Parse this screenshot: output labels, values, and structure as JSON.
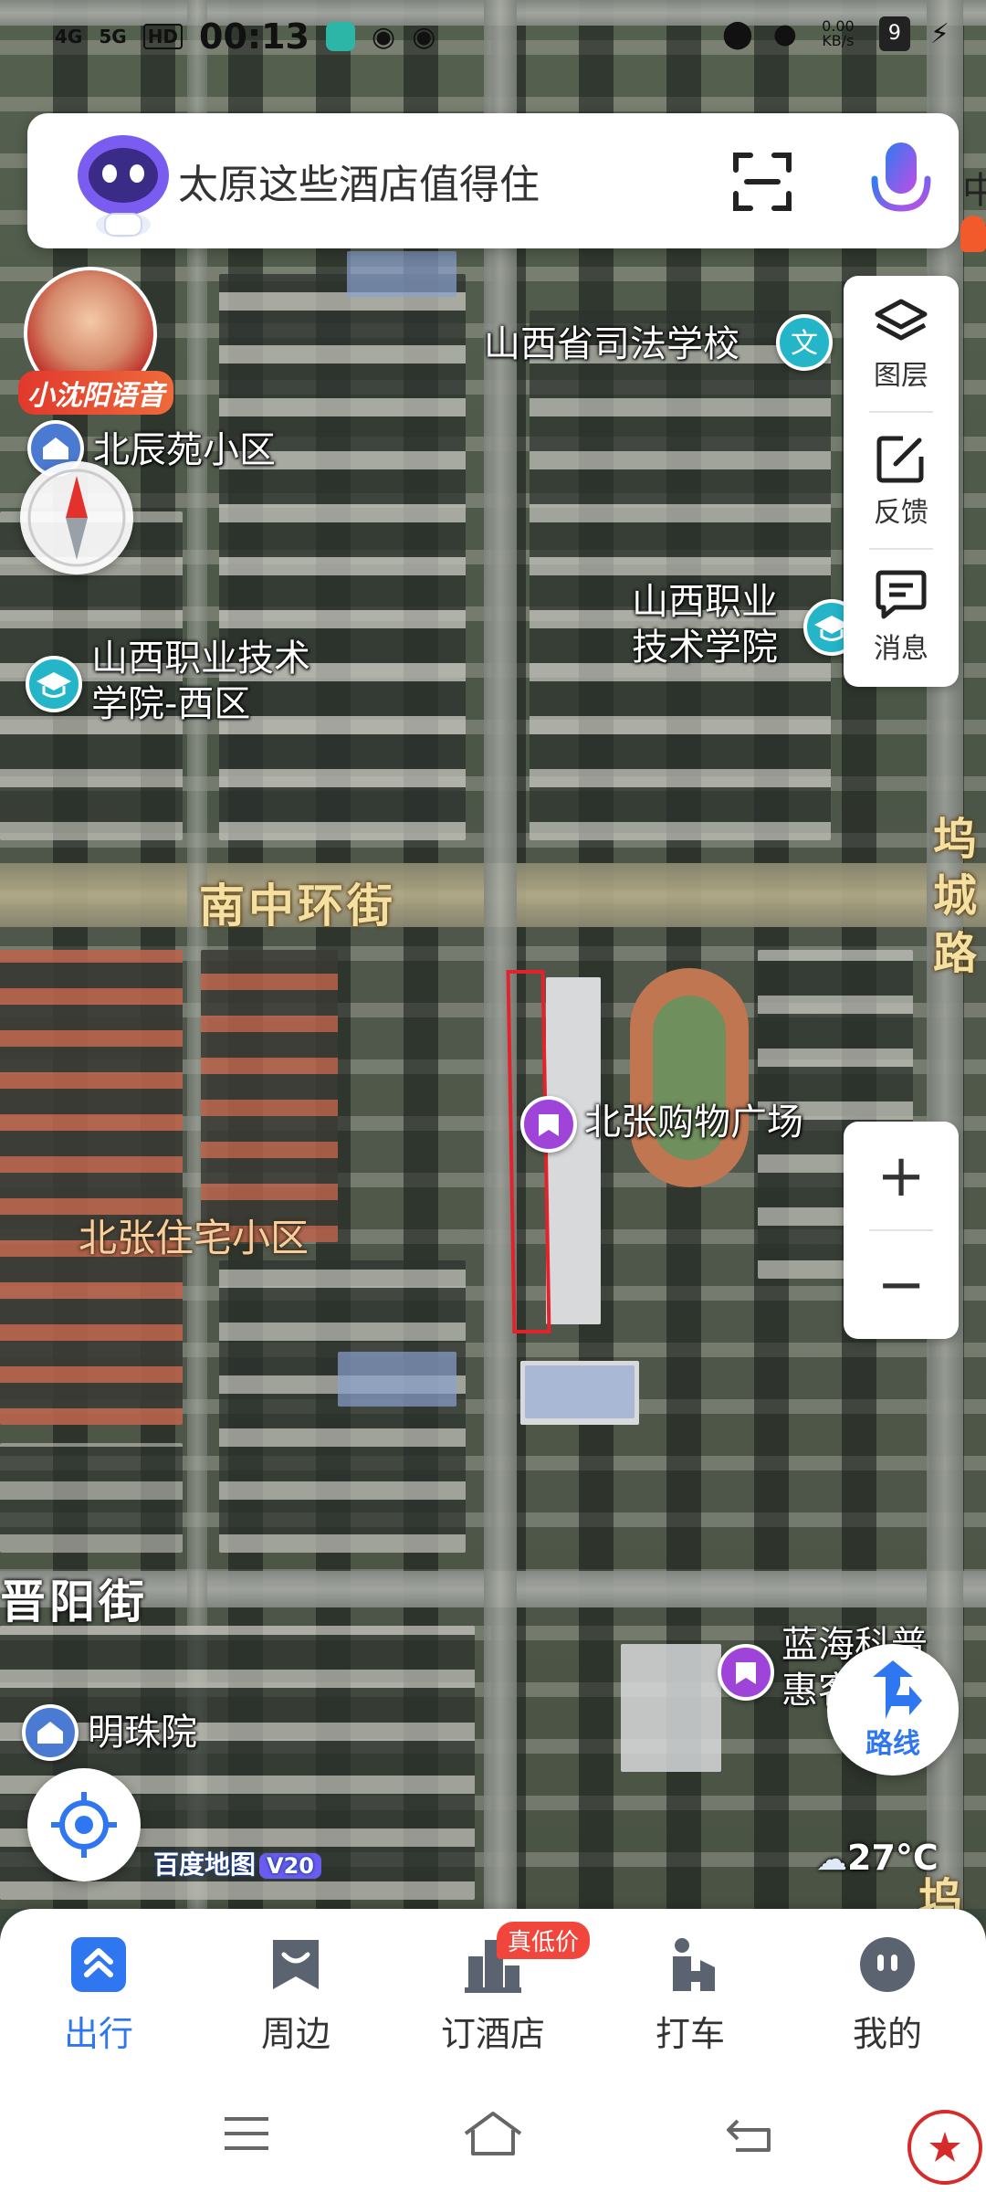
{
  "status_bar": {
    "signal_1": "4G",
    "signal_2": "5G",
    "hd_badge": "HD",
    "time": "00:13",
    "net_speed": "0.00 KB/s",
    "battery_level": "9"
  },
  "search": {
    "placeholder": "太原这些酒店值得住",
    "scan_icon": "scan-icon",
    "mic_icon": "microphone-icon"
  },
  "voice_assistant": {
    "label": "小沈阳语音"
  },
  "side_panel": {
    "items": [
      {
        "label": "图层",
        "icon": "layers-icon"
      },
      {
        "label": "反馈",
        "icon": "feedback-edit-icon"
      },
      {
        "label": "消息",
        "icon": "message-icon"
      }
    ]
  },
  "zoom": {
    "in_label": "+",
    "out_label": "−"
  },
  "map": {
    "poi": [
      {
        "name": "山西省司法学校",
        "type": "school"
      },
      {
        "name": "北辰苑小区",
        "type": "residential"
      },
      {
        "name": "山西职业\n技术学院",
        "type": "school"
      },
      {
        "name": "山西职业技术\n学院-西区",
        "type": "school"
      },
      {
        "name": "北张购物广场",
        "type": "shopping"
      },
      {
        "name": "蓝海科普\n惠客",
        "type": "shopping"
      },
      {
        "name": "明珠院",
        "type": "residential"
      }
    ],
    "roads": {
      "main_street": "南中环街",
      "jinyang_street": "晋阳街",
      "right_road": "坞城路",
      "right_road_partial": "坞"
    },
    "districts": {
      "beizhang": "北张住宅小区"
    },
    "right_edge_partial": "中"
  },
  "route_button": {
    "label": "路线"
  },
  "brand": {
    "name": "百度地图",
    "version": "V20"
  },
  "weather": {
    "temperature": "27°C"
  },
  "bottom_nav": {
    "items": [
      {
        "label": "出行",
        "icon": "travel-icon",
        "active": true
      },
      {
        "label": "周边",
        "icon": "nearby-icon",
        "active": false
      },
      {
        "label": "订酒店",
        "icon": "hotel-icon",
        "active": false
      },
      {
        "label": "打车",
        "icon": "taxi-icon",
        "active": false
      },
      {
        "label": "我的",
        "icon": "profile-icon",
        "active": false
      }
    ],
    "promo_badge": "真低价"
  },
  "colors": {
    "accent_blue": "#2f77f0",
    "parcel_highlight": "#e3222b",
    "promo_red": "#f0463c",
    "school_pin": "#25b5c9",
    "shop_pin": "#9f44d8",
    "residential_pin": "#4b7ad2"
  }
}
